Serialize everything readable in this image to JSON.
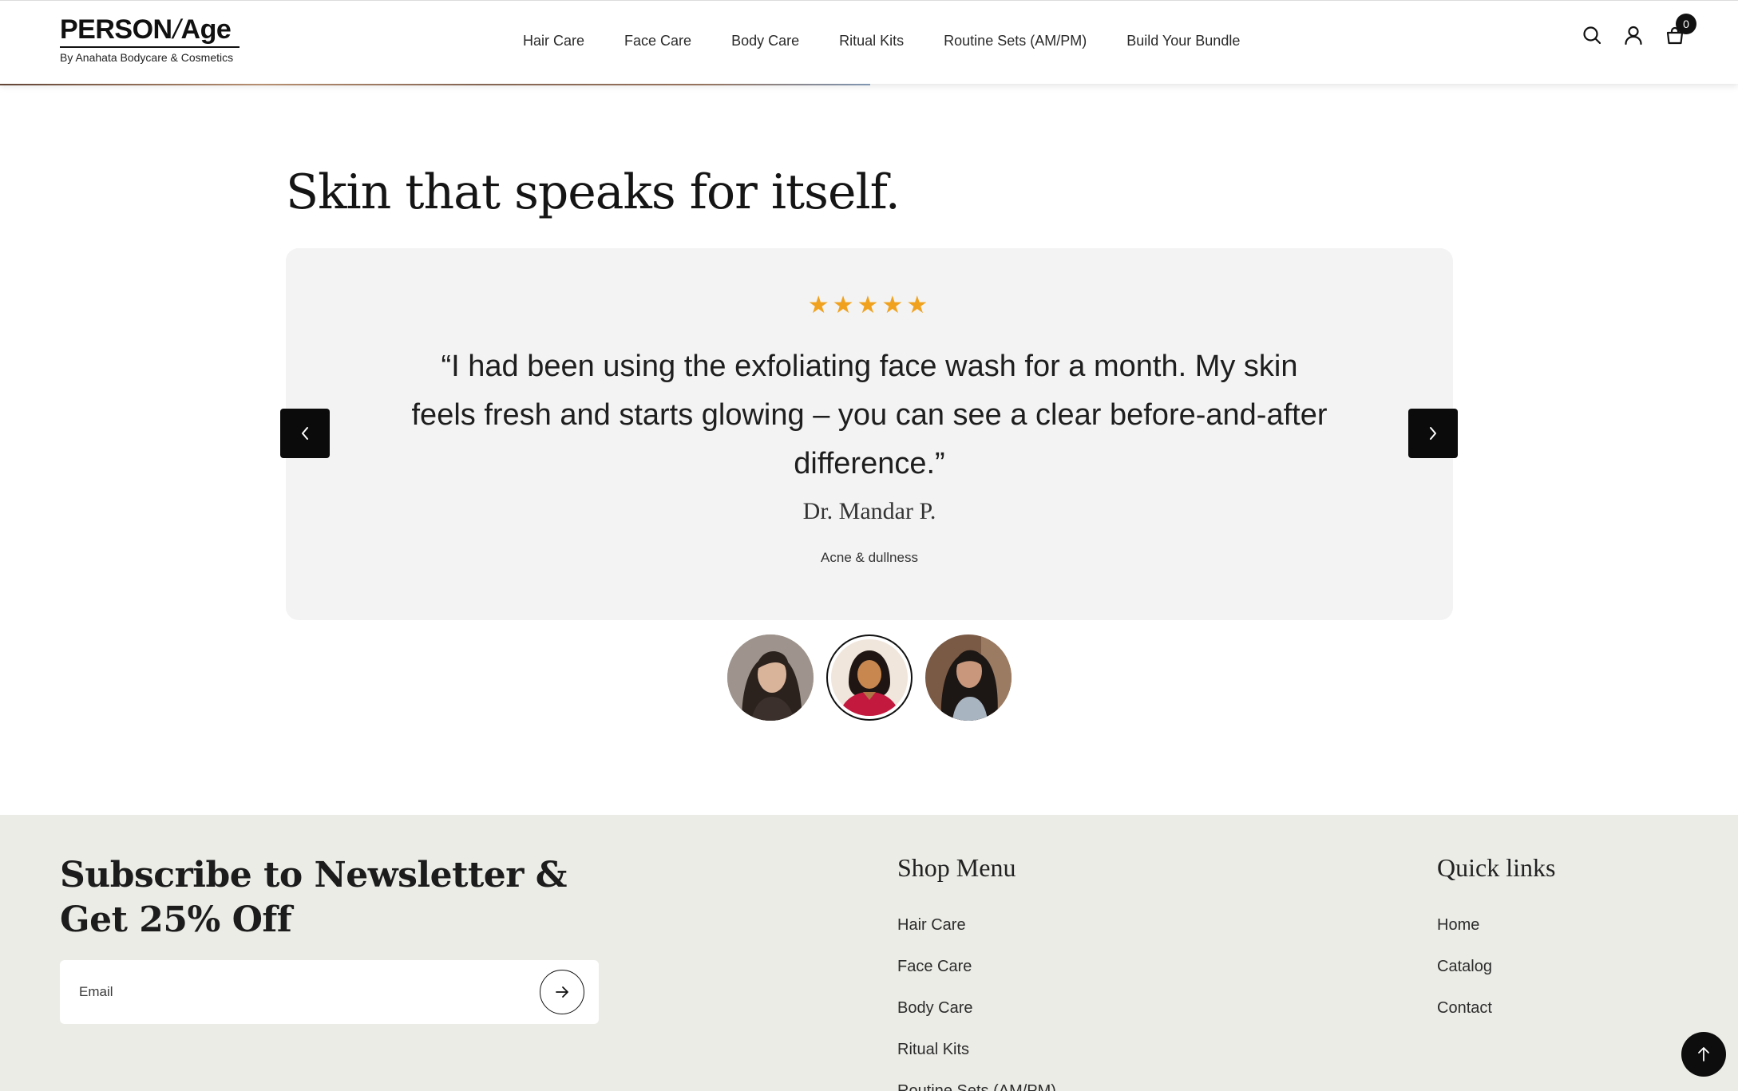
{
  "brand": {
    "name_left": "PERSON",
    "name_slash": "/",
    "name_right": "Age",
    "tagline": "By Anahata Bodycare & Cosmetics"
  },
  "nav": {
    "items": [
      "Hair Care",
      "Face Care",
      "Body Care",
      "Ritual Kits",
      "Routine Sets (AM/PM)",
      "Build Your Bundle"
    ]
  },
  "header_icons": {
    "search": "search-icon",
    "account": "user-icon",
    "cart": "bag-icon",
    "cart_count": "0"
  },
  "testimonials": {
    "title": "Skin that speaks for itself.",
    "stars": "★★★★★",
    "rating_of_5": 5,
    "star_color": "#f0a21e",
    "quote": "“I had been using the exfoliating face wash for a month. My skin feels fresh and starts glowing – you can see a clear before-and-after difference.”",
    "reviewer": "Dr. Mandar P.",
    "concern": "Acne & dullness",
    "active_avatar_index": 1
  },
  "newsletter": {
    "title": "Subscribe to Newsletter & Get 25% Off",
    "email_placeholder": "Email"
  },
  "footer": {
    "shop_menu_title": "Shop Menu",
    "shop_menu": [
      "Hair Care",
      "Face Care",
      "Body Care",
      "Ritual Kits",
      "Routine Sets (AM/PM)"
    ],
    "quick_links_title": "Quick links",
    "quick_links": [
      "Home",
      "Catalog",
      "Contact"
    ]
  },
  "colors": {
    "accent_dark": "#0b0b0b",
    "card_bg": "#f3f3f3",
    "footer_bg": "#ecece7"
  }
}
